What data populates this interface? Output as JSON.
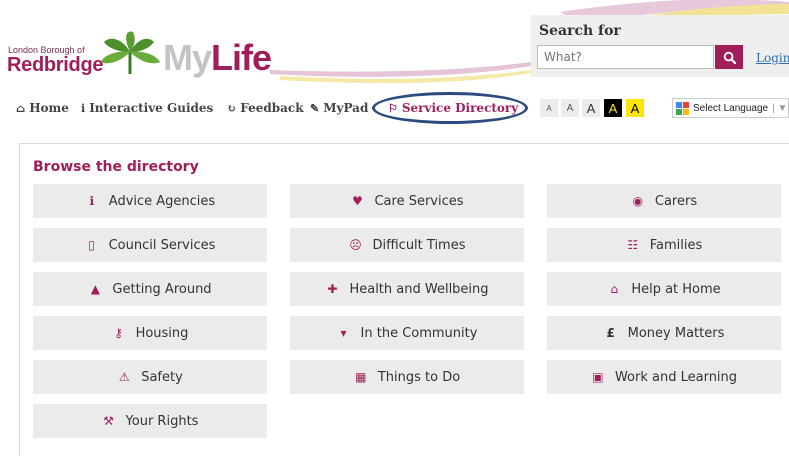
{
  "header": {
    "logo_small": "London Borough of",
    "logo_redbridge": "Redbridge",
    "logo_my": "My",
    "logo_life": "Life",
    "search_title": "Search for",
    "search_placeholder": "What?",
    "login_label": "Login",
    "brand_color": "#a01e5a"
  },
  "nav": {
    "items": [
      {
        "icon": "home-icon",
        "label": "Home"
      },
      {
        "icon": "info-icon",
        "label": "Interactive Guides"
      },
      {
        "icon": "refresh-icon",
        "label": "Feedback"
      },
      {
        "icon": "edit-icon",
        "label": "MyPad"
      },
      {
        "icon": "map-marker-icon",
        "label": "Service Directory"
      }
    ],
    "font_sizes": [
      "A",
      "A",
      "A",
      "A",
      "A"
    ],
    "language_label": "Select Language"
  },
  "directory": {
    "title": "Browse the directory",
    "items": [
      {
        "icon": "info-circle-icon",
        "label": "Advice Agencies"
      },
      {
        "icon": "heart-icon",
        "label": "Care Services"
      },
      {
        "icon": "eye-icon",
        "label": "Carers"
      },
      {
        "icon": "building-icon",
        "label": "Council Services"
      },
      {
        "icon": "frown-icon",
        "label": "Difficult Times"
      },
      {
        "icon": "users-icon",
        "label": "Families"
      },
      {
        "icon": "road-icon",
        "label": "Getting Around"
      },
      {
        "icon": "medkit-icon",
        "label": "Health and Wellbeing"
      },
      {
        "icon": "home-icon",
        "label": "Help at Home"
      },
      {
        "icon": "key-icon",
        "label": "Housing"
      },
      {
        "icon": "cart-icon",
        "label": "In the Community"
      },
      {
        "icon": "pound-icon",
        "label": "Money Matters"
      },
      {
        "icon": "warning-icon",
        "label": "Safety"
      },
      {
        "icon": "calendar-icon",
        "label": "Things to Do"
      },
      {
        "icon": "briefcase-icon",
        "label": "Work and Learning"
      },
      {
        "icon": "gavel-icon",
        "label": "Your Rights"
      }
    ]
  }
}
